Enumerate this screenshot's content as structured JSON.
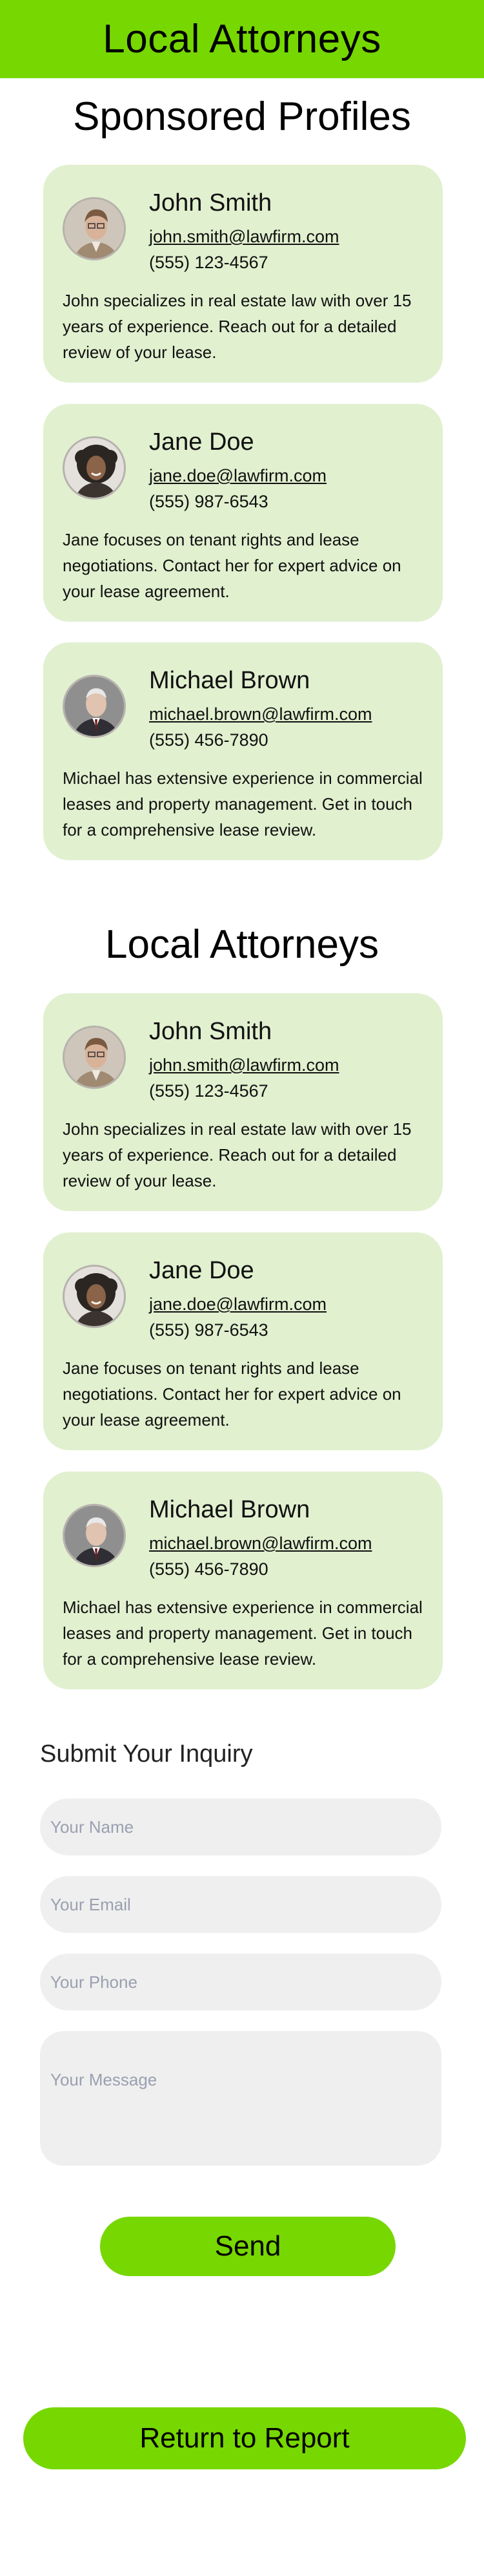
{
  "header": {
    "title": "Local Attorneys"
  },
  "sponsored": {
    "title": "Sponsored Profiles",
    "cards": [
      {
        "name": "John Smith",
        "email": "john.smith@lawfirm.com",
        "phone": "(555) 123-4567",
        "desc": "John specializes in real estate law with over 15 years of experience. Reach out for a detailed review of your lease."
      },
      {
        "name": "Jane Doe",
        "email": "jane.doe@lawfirm.com",
        "phone": "(555) 987-6543",
        "desc": "Jane focuses on tenant rights and lease negotiations. Contact her for expert advice on your lease agreement."
      },
      {
        "name": "Michael Brown",
        "email": "michael.brown@lawfirm.com",
        "phone": "(555) 456-7890",
        "desc": "Michael has extensive experience in commercial leases and property management. Get in touch for a comprehensive lease review."
      }
    ]
  },
  "local": {
    "title": "Local Attorneys",
    "cards": [
      {
        "name": "John Smith",
        "email": "john.smith@lawfirm.com",
        "phone": "(555) 123-4567",
        "desc": "John specializes in real estate law with over 15 years of experience. Reach out for a detailed review of your lease."
      },
      {
        "name": "Jane Doe",
        "email": "jane.doe@lawfirm.com",
        "phone": "(555) 987-6543",
        "desc": "Jane focuses on tenant rights and lease negotiations. Contact her for expert advice on your lease agreement."
      },
      {
        "name": "Michael Brown",
        "email": "michael.brown@lawfirm.com",
        "phone": "(555) 456-7890",
        "desc": "Michael has extensive experience in commercial leases and property management. Get in touch for a comprehensive lease review."
      }
    ]
  },
  "form": {
    "title": "Submit Your Inquiry",
    "name_placeholder": "Your Name",
    "email_placeholder": "Your Email",
    "phone_placeholder": "Your Phone",
    "message_placeholder": "Your Message",
    "send_label": "Send"
  },
  "footer": {
    "return_label": "Return to Report"
  },
  "colors": {
    "accent": "#77d700",
    "card_bg": "#e1f0cf",
    "field_bg": "#efefef"
  }
}
